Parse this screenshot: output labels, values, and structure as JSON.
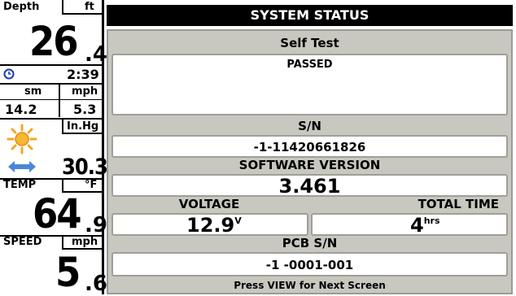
{
  "sidebar": {
    "depth": {
      "label": "Depth",
      "unit": "ft",
      "value_int": "26",
      "value_dec": ".4"
    },
    "time": {
      "value": "2:39",
      "icon": "clock-icon"
    },
    "distance": {
      "unit": "sm",
      "value": "14.2"
    },
    "speed_small": {
      "unit": "mph",
      "value": "5.3"
    },
    "pressure": {
      "unit": "In.Hg",
      "value": "30.3",
      "icons": [
        "sun-icon",
        "double-arrow-icon"
      ]
    },
    "temp": {
      "label": "TEMP",
      "unit": "°F",
      "value_int": "64",
      "value_dec": ".9"
    },
    "speed": {
      "label": "SPEED",
      "unit": "mph",
      "value_int": "5",
      "value_dec": ".6"
    }
  },
  "screen": {
    "title": "SYSTEM STATUS",
    "self_test": {
      "label": "Self Test",
      "value": "PASSED"
    },
    "sn": {
      "label": "S/N",
      "value": "-1-11420661826"
    },
    "software": {
      "label": "SOFTWARE VERSION",
      "value": "3.461"
    },
    "voltage": {
      "label": "VOLTAGE",
      "value": "12.9",
      "unit": "V"
    },
    "total_time": {
      "label": "TOTAL TIME",
      "value": "4",
      "unit": "hrs"
    },
    "pcb_sn": {
      "label": "PCB S/N",
      "value": "-1 -0001-001"
    },
    "footer": "Press VIEW for Next Screen"
  },
  "colors": {
    "panel": "#c8c8c0",
    "title_bg": "#000000",
    "sun": "#f5a623",
    "arrow": "#4a86d8"
  }
}
